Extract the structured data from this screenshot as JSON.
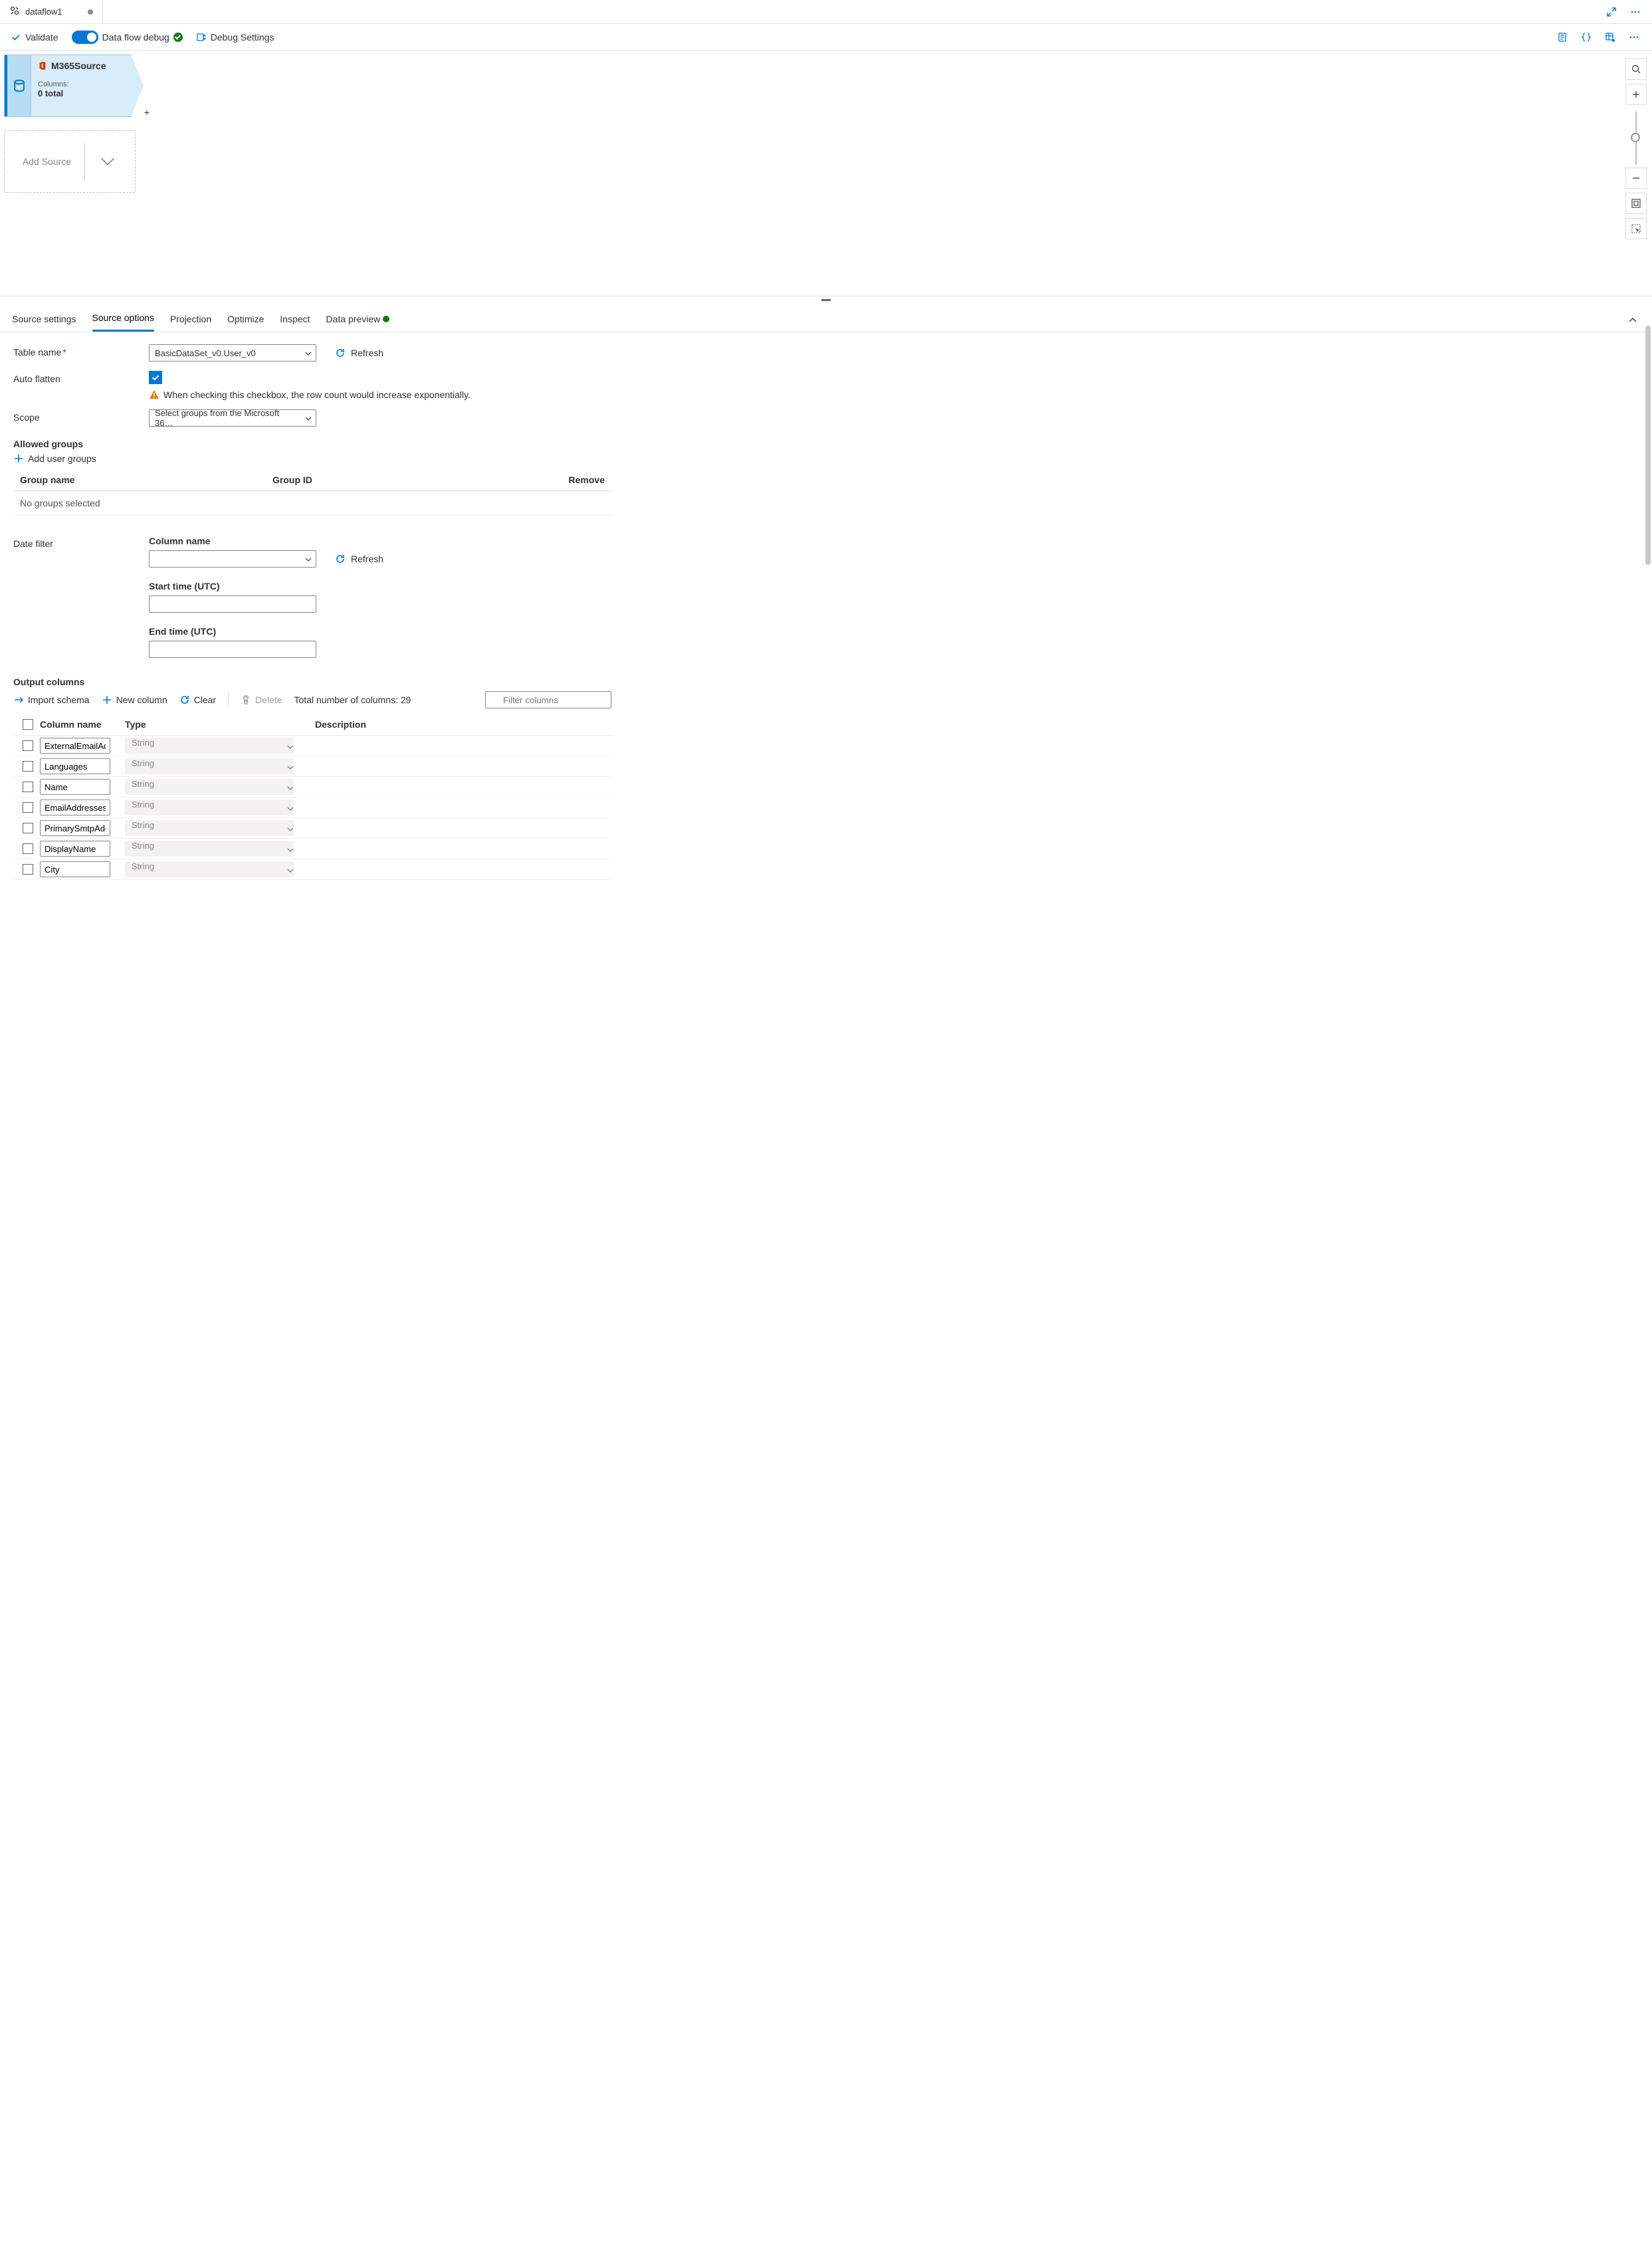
{
  "tab": {
    "label": "dataflow1"
  },
  "toolbar": {
    "validate": "Validate",
    "debug_toggle": "Data flow debug",
    "debug_settings": "Debug Settings"
  },
  "canvas": {
    "source_name": "M365Source",
    "columns_label": "Columns:",
    "columns_count": "0 total",
    "add_source": "Add Source"
  },
  "panel_tabs": {
    "source_settings": "Source settings",
    "source_options": "Source options",
    "projection": "Projection",
    "optimize": "Optimize",
    "inspect": "Inspect",
    "data_preview": "Data preview"
  },
  "form": {
    "table_name_label": "Table name",
    "table_name_value": "BasicDataSet_v0.User_v0",
    "refresh": "Refresh",
    "auto_flatten_label": "Auto flatten",
    "auto_flatten_warning": "When checking this checkbox, the row count would increase exponentially.",
    "scope_label": "Scope",
    "scope_value": "Select groups from the Microsoft 36…",
    "allowed_groups_heading": "Allowed groups",
    "add_user_groups": "Add user groups",
    "group_name_header": "Group name",
    "group_id_header": "Group ID",
    "remove_header": "Remove",
    "no_groups": "No groups selected",
    "date_filter_label": "Date filter",
    "column_name_label": "Column name",
    "start_time_label": "Start time (UTC)",
    "end_time_label": "End time (UTC)"
  },
  "output_columns": {
    "heading": "Output columns",
    "import_schema": "Import schema",
    "new_column": "New column",
    "clear": "Clear",
    "delete": "Delete",
    "total_label": "Total number of columns: 29",
    "filter_placeholder": "Filter columns",
    "th_column_name": "Column name",
    "th_type": "Type",
    "th_description": "Description",
    "rows": [
      {
        "name": "ExternalEmailAdd",
        "type": "String"
      },
      {
        "name": "Languages",
        "type": "String"
      },
      {
        "name": "Name",
        "type": "String"
      },
      {
        "name": "EmailAddresses",
        "type": "String"
      },
      {
        "name": "PrimarySmtpAddr",
        "type": "String"
      },
      {
        "name": "DisplayName",
        "type": "String"
      },
      {
        "name": "City",
        "type": "String"
      }
    ]
  }
}
